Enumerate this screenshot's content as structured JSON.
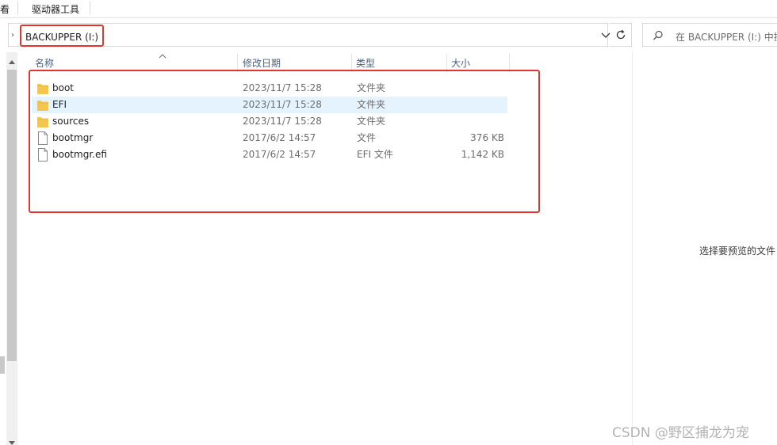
{
  "ribbon": {
    "tab_view": "看",
    "tab_drive_tools": "驱动器工具"
  },
  "address": {
    "path": "BACKUPPER (I:)"
  },
  "search": {
    "placeholder": "在 BACKUPPER (I:) 中搜"
  },
  "columns": {
    "name": "名称",
    "date_modified": "修改日期",
    "type": "类型",
    "size": "大小"
  },
  "files": [
    {
      "name": "boot",
      "date": "2023/11/7 15:28",
      "type": "文件夹",
      "size": "",
      "icon": "folder-icon",
      "selected": false
    },
    {
      "name": "EFI",
      "date": "2023/11/7 15:28",
      "type": "文件夹",
      "size": "",
      "icon": "folder-icon",
      "selected": true
    },
    {
      "name": "sources",
      "date": "2023/11/7 15:28",
      "type": "文件夹",
      "size": "",
      "icon": "folder-icon",
      "selected": false
    },
    {
      "name": "bootmgr",
      "date": "2017/6/2 14:57",
      "type": "文件",
      "size": "376 KB",
      "icon": "file-icon",
      "selected": false
    },
    {
      "name": "bootmgr.efi",
      "date": "2017/6/2 14:57",
      "type": "EFI 文件",
      "size": "1,142 KB",
      "icon": "file-icon",
      "selected": false
    }
  ],
  "preview": {
    "message": "选择要预览的文件"
  },
  "watermark": "CSDN @野区捕龙为宠",
  "colors": {
    "highlight": "#e5332d",
    "selection": "#e5f3ff",
    "folder": "#f3c74f"
  }
}
